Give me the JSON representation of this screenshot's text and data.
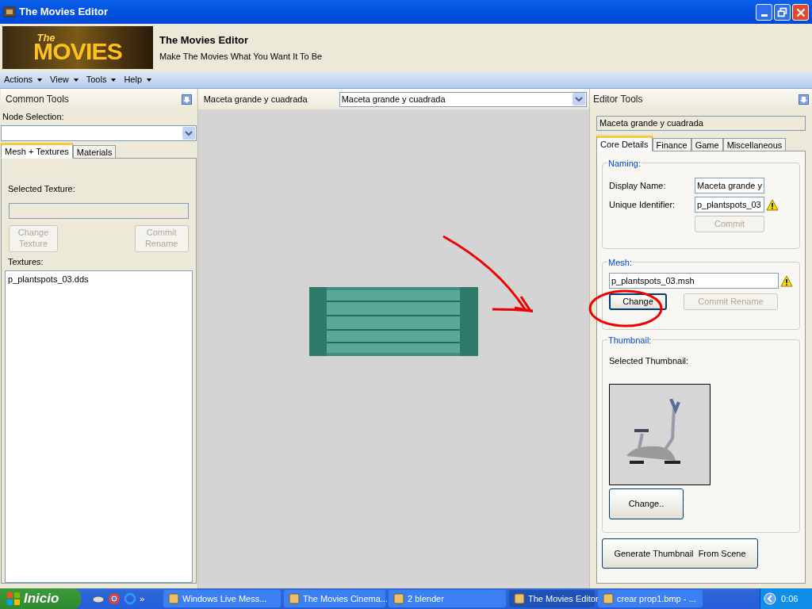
{
  "window": {
    "title": "The Movies Editor"
  },
  "header": {
    "logo_small": "The",
    "logo_big": "MOVIES",
    "title": "The Movies Editor",
    "subtitle": "Make The Movies What You Want It To Be"
  },
  "menu": [
    "Actions",
    "View",
    "Tools",
    "Help"
  ],
  "common_tools": {
    "title": "Common Tools",
    "node_label": "Node Selection:",
    "tabs": [
      {
        "label": "Mesh + Textures",
        "selected": true
      },
      {
        "label": "Materials",
        "selected": false
      }
    ],
    "selected_texture_label": "Selected Texture:",
    "buttons": [
      {
        "label": "Change Texture",
        "disabled": true
      },
      {
        "label": "Commit Rename",
        "disabled": true
      }
    ],
    "textures_label": "Textures:",
    "textures": [
      "p_plantspots_03.dds"
    ]
  },
  "viewport": {
    "label": "Maceta grande y cuadrada",
    "dropdown": "Maceta grande y cuadrada"
  },
  "editor_tools": {
    "title": "Editor Tools",
    "name": "Maceta grande y cuadrada",
    "tabs": [
      {
        "label": "Core Details",
        "selected": true
      },
      {
        "label": "Finance",
        "selected": false
      },
      {
        "label": "Game",
        "selected": false
      },
      {
        "label": "Miscellaneous",
        "selected": false
      }
    ],
    "naming": {
      "legend": "Naming:",
      "display_label": "Display Name:",
      "display_value": "Maceta grande y",
      "unique_label": "Unique Identifier:",
      "unique_value": "p_plantspots_03",
      "commit": {
        "label": "Commit",
        "disabled": true
      }
    },
    "mesh": {
      "legend": "Mesh:",
      "value": "p_plantspots_03.msh",
      "buttons": [
        {
          "label": "Change",
          "disabled": false
        },
        {
          "label": "Commit Rename",
          "disabled": true
        }
      ]
    },
    "thumbnail": {
      "legend": "Thumbnail:",
      "label": "Selected Thumbnail:",
      "change": "Change.."
    },
    "generate": "Generate Thumbnail  From Scene"
  },
  "taskbar": {
    "start": "Inicio",
    "items": [
      {
        "label": "Windows Live Mess...",
        "selected": false
      },
      {
        "label": "The Movies Cinema...",
        "selected": false
      },
      {
        "label": "2 blender",
        "selected": false
      },
      {
        "label": "The Movies Editor",
        "selected": true
      },
      {
        "label": "crear prop1.bmp - ...",
        "selected": false
      }
    ],
    "overflow": "»",
    "clock": "0:06"
  }
}
